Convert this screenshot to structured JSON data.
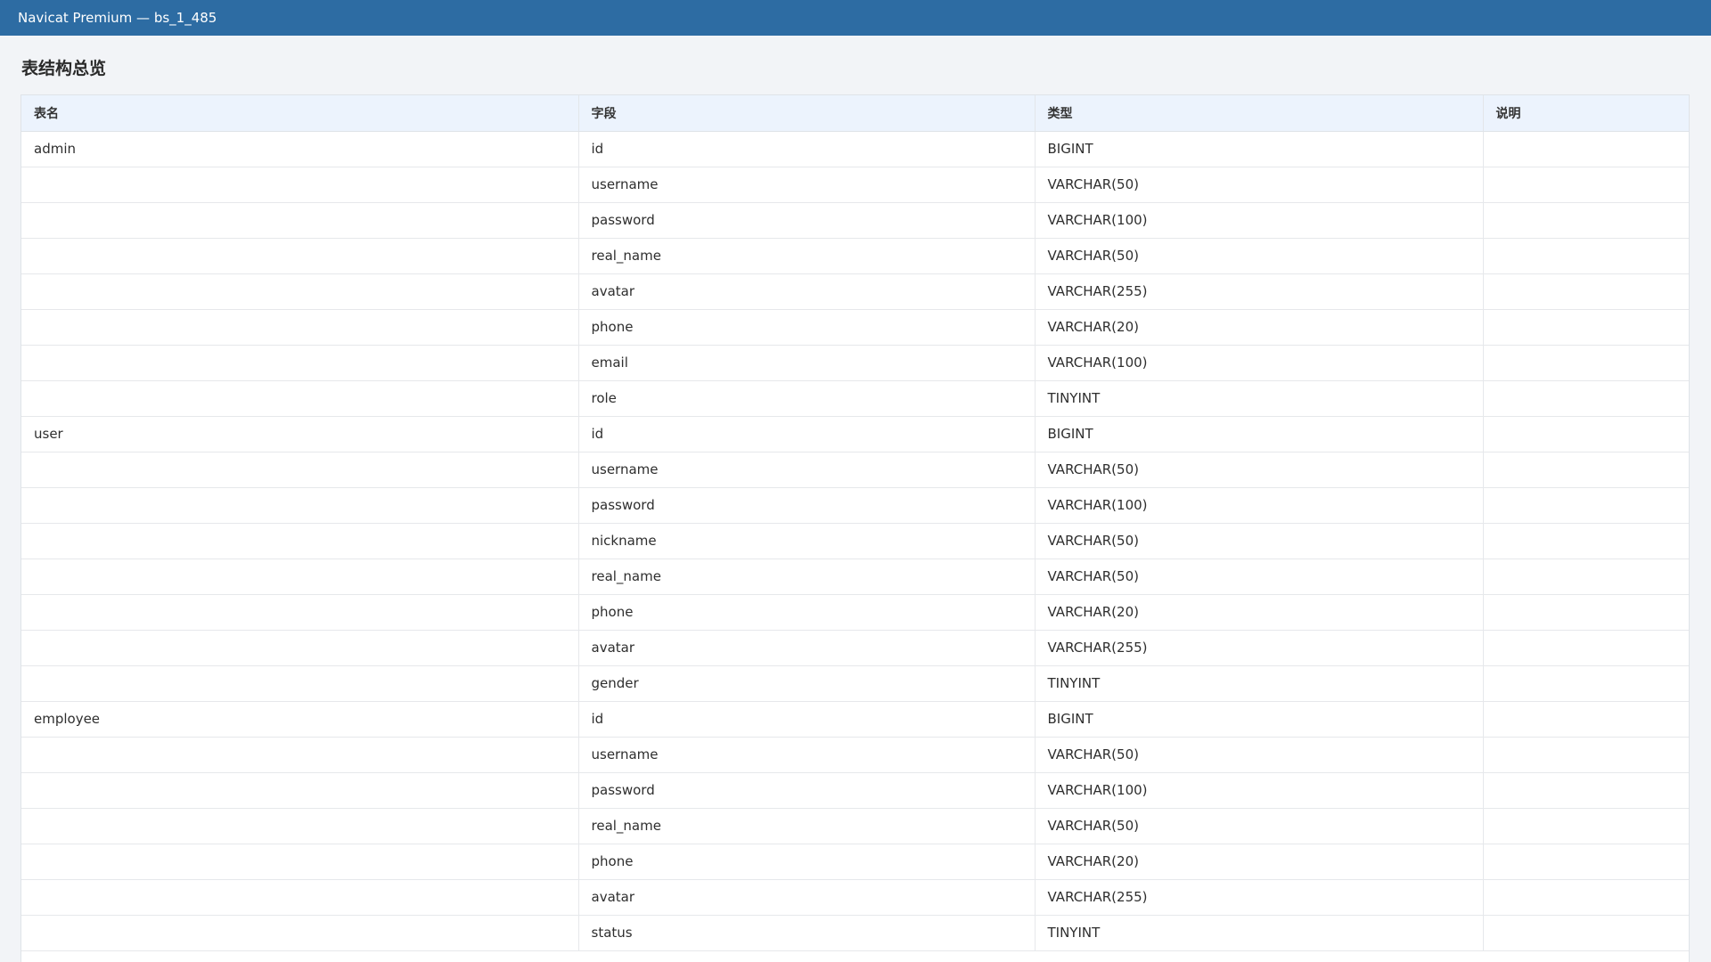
{
  "window": {
    "title": "Navicat Premium — bs_1_485"
  },
  "page": {
    "section_title": "表结构总览"
  },
  "table": {
    "headers": [
      "表名",
      "字段",
      "类型",
      "说明"
    ],
    "rows": [
      {
        "table": "admin",
        "field": "id",
        "type": "BIGINT",
        "desc": ""
      },
      {
        "table": "",
        "field": "username",
        "type": "VARCHAR(50)",
        "desc": ""
      },
      {
        "table": "",
        "field": "password",
        "type": "VARCHAR(100)",
        "desc": ""
      },
      {
        "table": "",
        "field": "real_name",
        "type": "VARCHAR(50)",
        "desc": ""
      },
      {
        "table": "",
        "field": "avatar",
        "type": "VARCHAR(255)",
        "desc": ""
      },
      {
        "table": "",
        "field": "phone",
        "type": "VARCHAR(20)",
        "desc": ""
      },
      {
        "table": "",
        "field": "email",
        "type": "VARCHAR(100)",
        "desc": ""
      },
      {
        "table": "",
        "field": "role",
        "type": "TINYINT",
        "desc": ""
      },
      {
        "table": "user",
        "field": "id",
        "type": "BIGINT",
        "desc": ""
      },
      {
        "table": "",
        "field": "username",
        "type": "VARCHAR(50)",
        "desc": ""
      },
      {
        "table": "",
        "field": "password",
        "type": "VARCHAR(100)",
        "desc": ""
      },
      {
        "table": "",
        "field": "nickname",
        "type": "VARCHAR(50)",
        "desc": ""
      },
      {
        "table": "",
        "field": "real_name",
        "type": "VARCHAR(50)",
        "desc": ""
      },
      {
        "table": "",
        "field": "phone",
        "type": "VARCHAR(20)",
        "desc": ""
      },
      {
        "table": "",
        "field": "avatar",
        "type": "VARCHAR(255)",
        "desc": ""
      },
      {
        "table": "",
        "field": "gender",
        "type": "TINYINT",
        "desc": ""
      },
      {
        "table": "employee",
        "field": "id",
        "type": "BIGINT",
        "desc": ""
      },
      {
        "table": "",
        "field": "username",
        "type": "VARCHAR(50)",
        "desc": ""
      },
      {
        "table": "",
        "field": "password",
        "type": "VARCHAR(100)",
        "desc": ""
      },
      {
        "table": "",
        "field": "real_name",
        "type": "VARCHAR(50)",
        "desc": ""
      },
      {
        "table": "",
        "field": "phone",
        "type": "VARCHAR(20)",
        "desc": ""
      },
      {
        "table": "",
        "field": "avatar",
        "type": "VARCHAR(255)",
        "desc": ""
      },
      {
        "table": "",
        "field": "status",
        "type": "TINYINT",
        "desc": ""
      }
    ]
  },
  "colors": {
    "titlebar": "#2d6ca3",
    "header_row": "#ecf3fd",
    "page_bg": "#f2f4f7"
  }
}
